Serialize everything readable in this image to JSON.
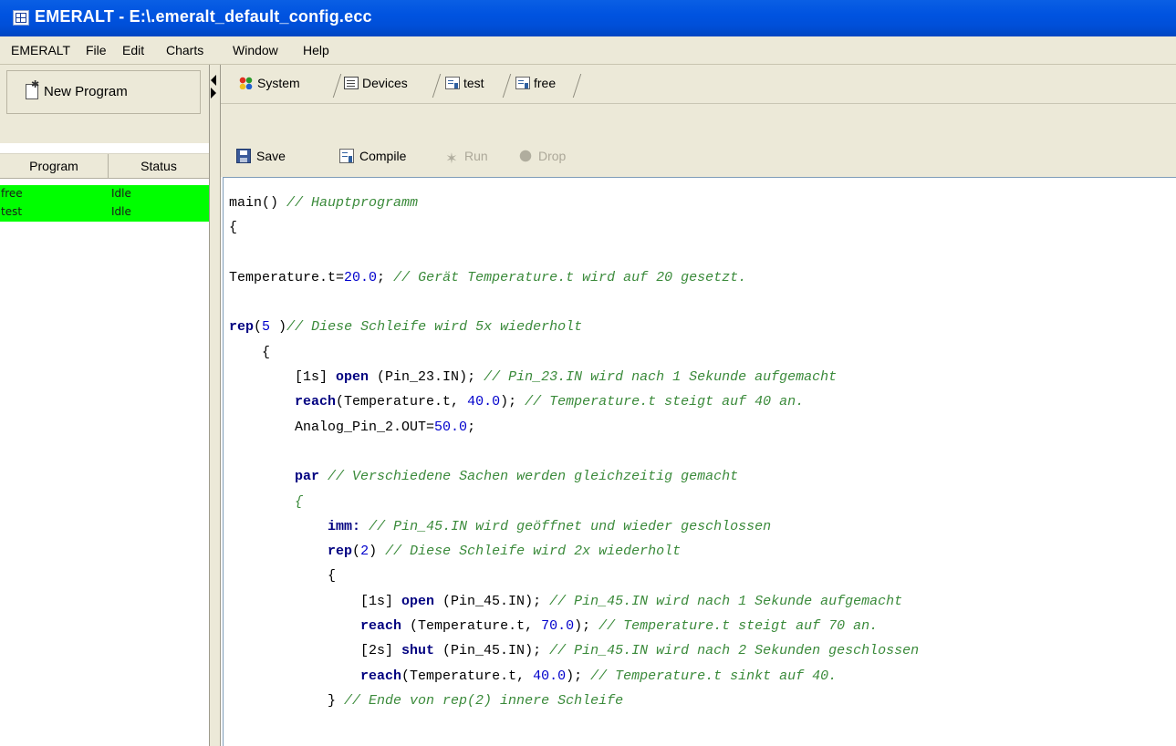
{
  "window": {
    "title": "EMERALT - E:\\.emeralt_default_config.ecc"
  },
  "menu": [
    "EMERALT",
    "File",
    "Edit",
    "Charts",
    "Window",
    "Help"
  ],
  "left_panel": {
    "new_program_label": "New Program",
    "columns": [
      "Program",
      "Status"
    ],
    "programs": [
      {
        "name": "free",
        "status": "Idle"
      },
      {
        "name": "test",
        "status": "Idle"
      }
    ],
    "row_color": "#00ff00"
  },
  "tabs": [
    {
      "label": "System",
      "icon": "system-icon"
    },
    {
      "label": "Devices",
      "icon": "devices-icon"
    },
    {
      "label": "test",
      "icon": "program-icon",
      "active": true
    },
    {
      "label": "free",
      "icon": "program-icon"
    }
  ],
  "toolbar": {
    "save_label": "Save",
    "compile_label": "Compile",
    "run_label": "Run",
    "drop_label": "Drop"
  },
  "editor": {
    "lines": [
      [
        [
          "t",
          "main() "
        ],
        [
          "c",
          "// Hauptprogramm"
        ]
      ],
      [
        [
          "t",
          "{"
        ]
      ],
      [],
      [
        [
          "t",
          "Temperature.t="
        ],
        [
          "n",
          "20.0"
        ],
        [
          "t",
          "; "
        ],
        [
          "c",
          "// Gerät Temperature.t wird auf 20 gesetzt."
        ]
      ],
      [],
      [
        [
          "k",
          "rep"
        ],
        [
          "t",
          "("
        ],
        [
          "n",
          "5"
        ],
        [
          "t",
          " )"
        ],
        [
          "c",
          "// Diese Schleife wird 5x wiederholt"
        ]
      ],
      [
        [
          "t",
          "    {"
        ]
      ],
      [
        [
          "t",
          "        [1s] "
        ],
        [
          "k",
          "open"
        ],
        [
          "t",
          " (Pin_23.IN); "
        ],
        [
          "c",
          "// Pin_23.IN wird nach 1 Sekunde aufgemacht"
        ]
      ],
      [
        [
          "t",
          "        "
        ],
        [
          "k",
          "reach"
        ],
        [
          "t",
          "(Temperature.t, "
        ],
        [
          "n",
          "40.0"
        ],
        [
          "t",
          "); "
        ],
        [
          "c",
          "// Temperature.t steigt auf 40 an."
        ]
      ],
      [
        [
          "t",
          "        Analog_Pin_2.OUT="
        ],
        [
          "n",
          "50.0"
        ],
        [
          "t",
          ";"
        ]
      ],
      [],
      [
        [
          "t",
          "        "
        ],
        [
          "k",
          "par"
        ],
        [
          "t",
          " "
        ],
        [
          "c",
          "// Verschiedene Sachen werden gleichzeitig gemacht"
        ]
      ],
      [
        [
          "t",
          "        "
        ],
        [
          "c",
          "{"
        ]
      ],
      [
        [
          "t",
          "            "
        ],
        [
          "k",
          "imm:"
        ],
        [
          "t",
          " "
        ],
        [
          "c",
          "// Pin_45.IN wird geöffnet und wieder geschlossen"
        ]
      ],
      [
        [
          "t",
          "            "
        ],
        [
          "k",
          "rep"
        ],
        [
          "t",
          "("
        ],
        [
          "n",
          "2"
        ],
        [
          "t",
          ") "
        ],
        [
          "c",
          "// Diese Schleife wird 2x wiederholt"
        ]
      ],
      [
        [
          "t",
          "            {"
        ]
      ],
      [
        [
          "t",
          "                [1s] "
        ],
        [
          "k",
          "open"
        ],
        [
          "t",
          " (Pin_45.IN); "
        ],
        [
          "c",
          "// Pin_45.IN wird nach 1 Sekunde aufgemacht"
        ]
      ],
      [
        [
          "t",
          "                "
        ],
        [
          "k",
          "reach"
        ],
        [
          "t",
          " (Temperature.t, "
        ],
        [
          "n",
          "70.0"
        ],
        [
          "t",
          "); "
        ],
        [
          "c",
          "// Temperature.t steigt auf 70 an."
        ]
      ],
      [
        [
          "t",
          "                [2s] "
        ],
        [
          "k",
          "shut"
        ],
        [
          "t",
          " (Pin_45.IN); "
        ],
        [
          "c",
          "// Pin_45.IN wird nach 2 Sekunden geschlossen"
        ]
      ],
      [
        [
          "t",
          "                "
        ],
        [
          "k",
          "reach"
        ],
        [
          "t",
          "(Temperature.t, "
        ],
        [
          "n",
          "40.0"
        ],
        [
          "t",
          "); "
        ],
        [
          "c",
          "// Temperature.t sinkt auf 40."
        ]
      ],
      [
        [
          "t",
          "            } "
        ],
        [
          "c",
          "// Ende von rep(2) innere Schleife"
        ]
      ]
    ]
  }
}
